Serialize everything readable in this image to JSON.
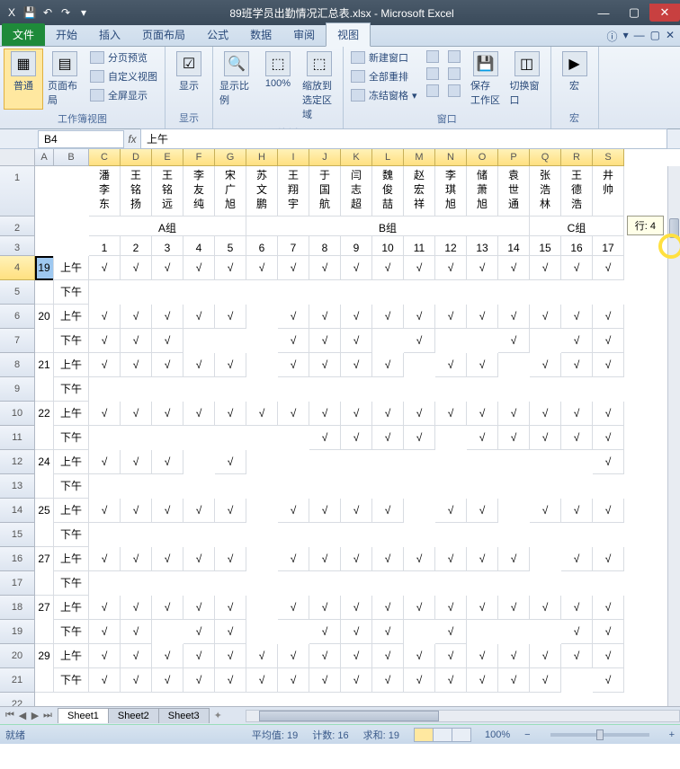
{
  "title": "89班学员出勤情况汇总表.xlsx - Microsoft Excel",
  "qat": {
    "excel": "X",
    "save": "💾",
    "undo": "↶",
    "redo": "↷"
  },
  "tabs": {
    "file": "文件",
    "home": "开始",
    "insert": "插入",
    "layout": "页面布局",
    "formulas": "公式",
    "data": "数据",
    "review": "审阅",
    "view": "视图"
  },
  "ribbon": {
    "g1": {
      "normal": "普通",
      "pagelayout": "页面布局",
      "pagebreak": "分页预览",
      "custom": "自定义视图",
      "full": "全屏显示",
      "label": "工作簿视图"
    },
    "g2": {
      "show": "显示",
      "label": "显示"
    },
    "g3": {
      "ratio": "显示比例",
      "hundred": "100%",
      "zoomsel": "缩放到\n选定区域",
      "label": "显示比例"
    },
    "g4": {
      "newwin": "新建窗口",
      "arrange": "全部重排",
      "freeze": "冻结窗格",
      "save": "保存\n工作区",
      "switch": "切换窗口",
      "label": "窗口"
    },
    "g5": {
      "macro": "宏",
      "label": "宏"
    }
  },
  "namebox": "B4",
  "fx": "fx",
  "formula": "上午",
  "scrolltip": "行: 4",
  "cols": [
    "A",
    "B",
    "C",
    "D",
    "E",
    "F",
    "G",
    "H",
    "I",
    "J",
    "K",
    "L",
    "M",
    "N",
    "O",
    "P",
    "Q",
    "R",
    "S"
  ],
  "rows": [
    "1",
    "2",
    "3",
    "4",
    "5",
    "6",
    "7",
    "8",
    "9",
    "10",
    "11",
    "12",
    "13",
    "14",
    "15",
    "16",
    "17",
    "18",
    "19",
    "20",
    "21",
    "22"
  ],
  "names": [
    "潘李东",
    "王铭扬",
    "王铭远",
    "李友纯",
    "宋广旭",
    "苏文鹏",
    "王翔宇",
    "于国航",
    "闫志超",
    "魏俊喆",
    "赵宏祥",
    "李琪旭",
    "储萧旭",
    "袁世通",
    "张浩林",
    "王德浩",
    "井帅"
  ],
  "groups": {
    "a": "A组",
    "b": "B组",
    "c": "C组"
  },
  "nums": [
    "1",
    "2",
    "3",
    "4",
    "5",
    "6",
    "7",
    "8",
    "9",
    "10",
    "11",
    "12",
    "13",
    "14",
    "15",
    "16",
    "17"
  ],
  "days": [
    "19",
    "20",
    "21",
    "22",
    "24",
    "25",
    "27",
    "27",
    "29"
  ],
  "am": "上午",
  "pm": "下午",
  "sheets": {
    "s1": "Sheet1",
    "s2": "Sheet2",
    "s3": "Sheet3"
  },
  "status": {
    "ready": "就绪",
    "avg": "平均值: 19",
    "cnt": "计数: 16",
    "sum": "求和: 19",
    "zoom": "100%"
  },
  "attendance": [
    [
      1,
      1,
      1,
      1,
      1,
      1,
      1,
      1,
      1,
      1,
      1,
      1,
      1,
      1,
      1,
      1,
      1
    ],
    [
      0,
      0,
      0,
      0,
      0,
      0,
      0,
      0,
      0,
      0,
      0,
      0,
      0,
      0,
      0,
      0,
      0
    ],
    [
      1,
      1,
      1,
      1,
      1,
      0,
      1,
      1,
      1,
      1,
      1,
      1,
      1,
      1,
      1,
      1,
      1
    ],
    [
      1,
      1,
      1,
      0,
      0,
      0,
      1,
      1,
      1,
      0,
      1,
      0,
      0,
      1,
      0,
      1,
      1
    ],
    [
      1,
      1,
      1,
      1,
      1,
      0,
      1,
      1,
      1,
      1,
      0,
      1,
      1,
      0,
      1,
      1,
      1
    ],
    [
      0,
      0,
      0,
      0,
      0,
      0,
      0,
      0,
      0,
      0,
      0,
      0,
      0,
      0,
      0,
      0,
      0
    ],
    [
      1,
      1,
      1,
      1,
      1,
      1,
      1,
      1,
      1,
      1,
      1,
      1,
      1,
      1,
      1,
      1,
      1
    ],
    [
      0,
      0,
      0,
      0,
      0,
      0,
      0,
      1,
      1,
      1,
      1,
      0,
      1,
      1,
      1,
      1,
      1
    ],
    [
      1,
      1,
      1,
      0,
      1,
      0,
      0,
      0,
      0,
      0,
      0,
      0,
      0,
      0,
      0,
      0,
      1
    ],
    [
      0,
      0,
      0,
      0,
      0,
      0,
      0,
      0,
      0,
      0,
      0,
      0,
      0,
      0,
      0,
      0,
      0
    ],
    [
      1,
      1,
      1,
      1,
      1,
      0,
      1,
      1,
      1,
      1,
      0,
      1,
      1,
      0,
      1,
      1,
      1
    ],
    [
      0,
      0,
      0,
      0,
      0,
      0,
      0,
      0,
      0,
      0,
      0,
      0,
      0,
      0,
      0,
      0,
      0
    ],
    [
      1,
      1,
      1,
      1,
      1,
      0,
      1,
      1,
      1,
      1,
      1,
      1,
      1,
      1,
      0,
      1,
      1
    ],
    [
      0,
      0,
      0,
      0,
      0,
      0,
      0,
      0,
      0,
      0,
      0,
      0,
      0,
      0,
      0,
      0,
      0
    ],
    [
      1,
      1,
      1,
      1,
      1,
      0,
      1,
      1,
      1,
      1,
      1,
      1,
      1,
      1,
      1,
      1,
      1
    ],
    [
      1,
      1,
      0,
      1,
      1,
      0,
      0,
      1,
      1,
      1,
      0,
      1,
      0,
      0,
      0,
      1,
      1
    ],
    [
      1,
      1,
      1,
      1,
      1,
      1,
      1,
      1,
      1,
      1,
      1,
      1,
      1,
      1,
      1,
      1,
      1
    ],
    [
      1,
      1,
      1,
      1,
      1,
      1,
      1,
      1,
      1,
      1,
      1,
      1,
      1,
      1,
      1,
      0,
      1
    ]
  ],
  "chart_data": {
    "type": "table",
    "title": "89班学员出勤情况汇总表",
    "columns": [
      "潘李东",
      "王铭扬",
      "王铭远",
      "李友纯",
      "宋广旭",
      "苏文鹏",
      "王翔宇",
      "于国航",
      "闫志超",
      "魏俊喆",
      "赵宏祥",
      "李琪旭",
      "储萧旭",
      "袁世通",
      "张浩林",
      "王德浩",
      "井帅"
    ],
    "groups": {
      "A组": [
        1,
        5
      ],
      "B组": [
        6,
        14
      ],
      "C组": [
        15,
        17
      ]
    },
    "rows": [
      {
        "day": 19,
        "slot": "上午",
        "present": [
          1,
          1,
          1,
          1,
          1,
          1,
          1,
          1,
          1,
          1,
          1,
          1,
          1,
          1,
          1,
          1,
          1
        ]
      },
      {
        "day": 19,
        "slot": "下午",
        "present": [
          0,
          0,
          0,
          0,
          0,
          0,
          0,
          0,
          0,
          0,
          0,
          0,
          0,
          0,
          0,
          0,
          0
        ]
      },
      {
        "day": 20,
        "slot": "上午",
        "present": [
          1,
          1,
          1,
          1,
          1,
          0,
          1,
          1,
          1,
          1,
          1,
          1,
          1,
          1,
          1,
          1,
          1
        ]
      },
      {
        "day": 20,
        "slot": "下午",
        "present": [
          1,
          1,
          1,
          0,
          0,
          0,
          1,
          1,
          1,
          0,
          1,
          0,
          0,
          1,
          0,
          1,
          1
        ]
      },
      {
        "day": 21,
        "slot": "上午",
        "present": [
          1,
          1,
          1,
          1,
          1,
          0,
          1,
          1,
          1,
          1,
          0,
          1,
          1,
          0,
          1,
          1,
          1
        ]
      },
      {
        "day": 21,
        "slot": "下午",
        "present": [
          0,
          0,
          0,
          0,
          0,
          0,
          0,
          0,
          0,
          0,
          0,
          0,
          0,
          0,
          0,
          0,
          0
        ]
      },
      {
        "day": 22,
        "slot": "上午",
        "present": [
          1,
          1,
          1,
          1,
          1,
          1,
          1,
          1,
          1,
          1,
          1,
          1,
          1,
          1,
          1,
          1,
          1
        ]
      },
      {
        "day": 22,
        "slot": "下午",
        "present": [
          0,
          0,
          0,
          0,
          0,
          0,
          0,
          1,
          1,
          1,
          1,
          0,
          1,
          1,
          1,
          1,
          1
        ]
      },
      {
        "day": 24,
        "slot": "上午",
        "present": [
          1,
          1,
          1,
          0,
          1,
          0,
          0,
          0,
          0,
          0,
          0,
          0,
          0,
          0,
          0,
          0,
          1
        ]
      },
      {
        "day": 24,
        "slot": "下午",
        "present": [
          0,
          0,
          0,
          0,
          0,
          0,
          0,
          0,
          0,
          0,
          0,
          0,
          0,
          0,
          0,
          0,
          0
        ]
      },
      {
        "day": 25,
        "slot": "上午",
        "present": [
          1,
          1,
          1,
          1,
          1,
          0,
          1,
          1,
          1,
          1,
          0,
          1,
          1,
          0,
          1,
          1,
          1
        ]
      },
      {
        "day": 25,
        "slot": "下午",
        "present": [
          0,
          0,
          0,
          0,
          0,
          0,
          0,
          0,
          0,
          0,
          0,
          0,
          0,
          0,
          0,
          0,
          0
        ]
      },
      {
        "day": 27,
        "slot": "上午",
        "present": [
          1,
          1,
          1,
          1,
          1,
          0,
          1,
          1,
          1,
          1,
          1,
          1,
          1,
          1,
          0,
          1,
          1
        ]
      },
      {
        "day": 27,
        "slot": "下午",
        "present": [
          0,
          0,
          0,
          0,
          0,
          0,
          0,
          0,
          0,
          0,
          0,
          0,
          0,
          0,
          0,
          0,
          0
        ]
      },
      {
        "day": 27,
        "slot": "上午",
        "present": [
          1,
          1,
          1,
          1,
          1,
          0,
          1,
          1,
          1,
          1,
          1,
          1,
          1,
          1,
          1,
          1,
          1
        ]
      },
      {
        "day": 27,
        "slot": "下午",
        "present": [
          1,
          1,
          0,
          1,
          1,
          0,
          0,
          1,
          1,
          1,
          0,
          1,
          0,
          0,
          0,
          1,
          1
        ]
      },
      {
        "day": 29,
        "slot": "上午",
        "present": [
          1,
          1,
          1,
          1,
          1,
          1,
          1,
          1,
          1,
          1,
          1,
          1,
          1,
          1,
          1,
          1,
          1
        ]
      },
      {
        "day": 29,
        "slot": "下午",
        "present": [
          1,
          1,
          1,
          1,
          1,
          1,
          1,
          1,
          1,
          1,
          1,
          1,
          1,
          1,
          1,
          0,
          1
        ]
      }
    ]
  }
}
